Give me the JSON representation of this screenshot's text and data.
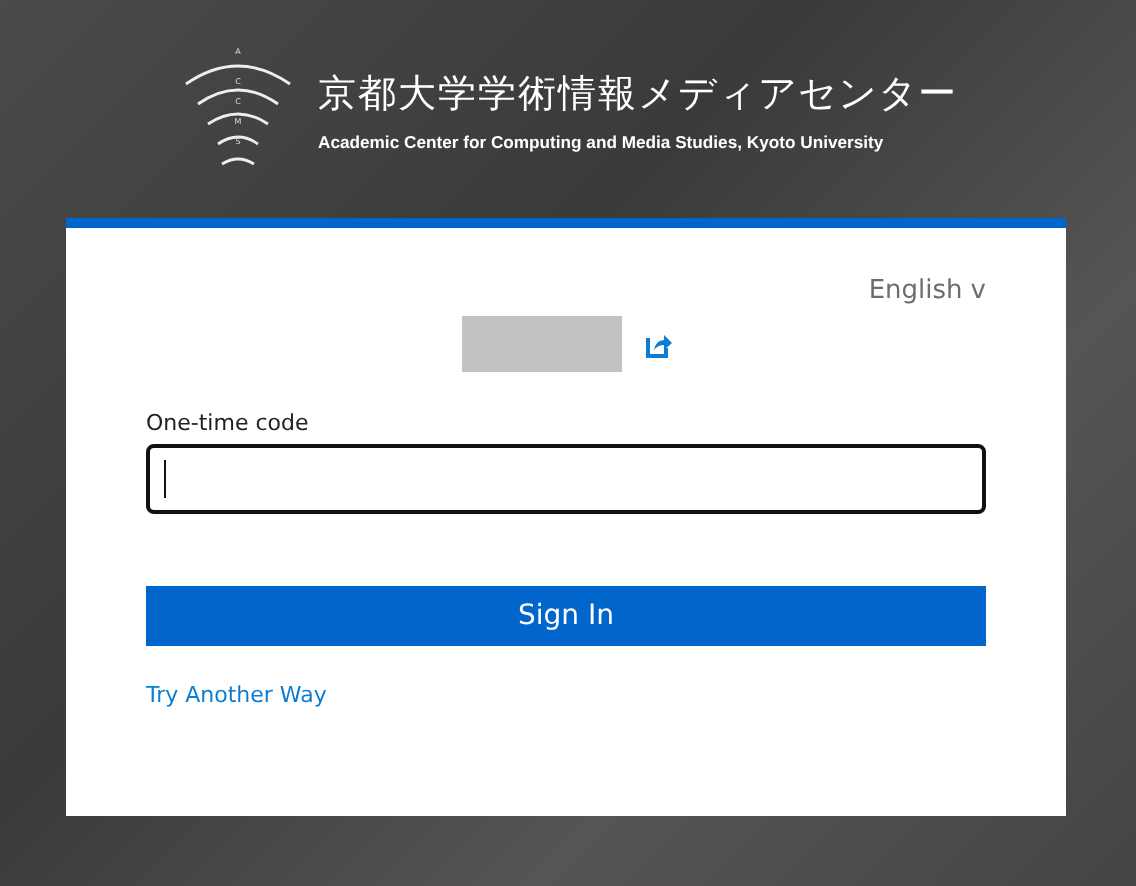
{
  "header": {
    "logo_letters": [
      "A",
      "C",
      "C",
      "M",
      "S"
    ],
    "title": "京都大学学術情報メディアセンター",
    "subtitle": "Academic Center for Computing and Media Studies, Kyoto University"
  },
  "card": {
    "language": "English",
    "language_caret": "v",
    "field": {
      "label": "One-time code",
      "focused": true
    },
    "submit": "Sign In",
    "alt_link": "Try Another Way"
  }
}
